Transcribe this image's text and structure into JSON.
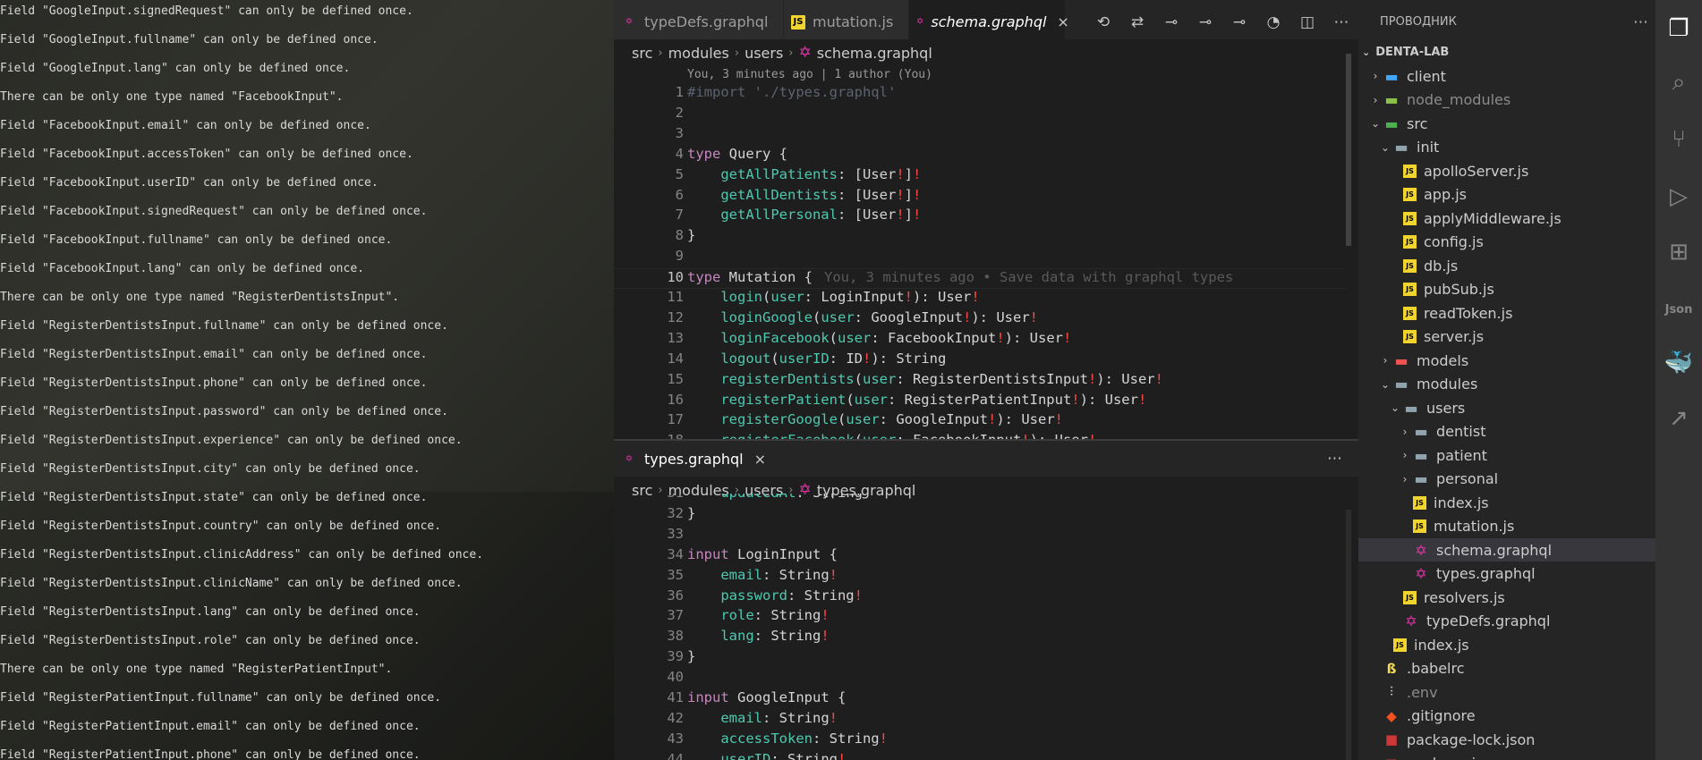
{
  "terminal": {
    "lines": [
      "Field \"GoogleInput.signedRequest\" can only be defined once.",
      "Field \"GoogleInput.fullname\" can only be defined once.",
      "Field \"GoogleInput.lang\" can only be defined once.",
      "There can be only one type named \"FacebookInput\".",
      "Field \"FacebookInput.email\" can only be defined once.",
      "Field \"FacebookInput.accessToken\" can only be defined once.",
      "Field \"FacebookInput.userID\" can only be defined once.",
      "Field \"FacebookInput.signedRequest\" can only be defined once.",
      "Field \"FacebookInput.fullname\" can only be defined once.",
      "Field \"FacebookInput.lang\" can only be defined once.",
      "There can be only one type named \"RegisterDentistsInput\".",
      "Field \"RegisterDentistsInput.fullname\" can only be defined once.",
      "Field \"RegisterDentistsInput.email\" can only be defined once.",
      "Field \"RegisterDentistsInput.phone\" can only be defined once.",
      "Field \"RegisterDentistsInput.password\" can only be defined once.",
      "Field \"RegisterDentistsInput.experience\" can only be defined once.",
      "Field \"RegisterDentistsInput.city\" can only be defined once.",
      "Field \"RegisterDentistsInput.state\" can only be defined once.",
      "Field \"RegisterDentistsInput.country\" can only be defined once.",
      "Field \"RegisterDentistsInput.clinicAddress\" can only be defined once.",
      "Field \"RegisterDentistsInput.clinicName\" can only be defined once.",
      "Field \"RegisterDentistsInput.lang\" can only be defined once.",
      "Field \"RegisterDentistsInput.role\" can only be defined once.",
      "There can be only one type named \"RegisterPatientInput\".",
      "Field \"RegisterPatientInput.fullname\" can only be defined once.",
      "Field \"RegisterPatientInput.email\" can only be defined once.",
      "Field \"RegisterPatientInput.phone\" can only be defined once."
    ]
  },
  "editor_top": {
    "tabs": [
      {
        "label": "typeDefs.graphql",
        "icon": "graphql-icon"
      },
      {
        "label": "mutation.js",
        "icon": "js-icon"
      },
      {
        "label": "schema.graphql",
        "icon": "graphql-icon",
        "active": true
      }
    ],
    "breadcrumb": [
      "src",
      "modules",
      "users",
      "schema.graphql"
    ],
    "codelens": "You, 3 minutes ago | 1 author (You)",
    "blame": "You, 3 minutes ago • Save data with graphql types",
    "lines": [
      {
        "n": "1",
        "t": "#import './types.graphql'"
      },
      {
        "n": "2",
        "t": ""
      },
      {
        "n": "3",
        "t": ""
      },
      {
        "n": "4",
        "t": "type Query {"
      },
      {
        "n": "5",
        "t": "    getAllPatients: [User!]!"
      },
      {
        "n": "6",
        "t": "    getAllDentists: [User!]!"
      },
      {
        "n": "7",
        "t": "    getAllPersonal: [User!]!"
      },
      {
        "n": "8",
        "t": "}"
      },
      {
        "n": "9",
        "t": ""
      },
      {
        "n": "10",
        "t": "type Mutation {"
      },
      {
        "n": "11",
        "t": "    login(user: LoginInput!): User!"
      },
      {
        "n": "12",
        "t": "    loginGoogle(user: GoogleInput!): User!"
      },
      {
        "n": "13",
        "t": "    loginFacebook(user: FacebookInput!): User!"
      },
      {
        "n": "14",
        "t": "    logout(userID: ID!): String"
      },
      {
        "n": "15",
        "t": "    registerDentists(user: RegisterDentistsInput!): User!"
      },
      {
        "n": "16",
        "t": "    registerPatient(user: RegisterPatientInput!): User!"
      },
      {
        "n": "17",
        "t": "    registerGoogle(user: GoogleInput!): User!"
      },
      {
        "n": "18",
        "t": "    registerFacebook(user: FacebookInput!): User!"
      }
    ]
  },
  "editor_bottom": {
    "tab": {
      "label": "types.graphql",
      "icon": "graphql-icon"
    },
    "breadcrumb": [
      "src",
      "modules",
      "users",
      "types.graphql"
    ],
    "lines": [
      {
        "n": "31",
        "t": "    updatedAt: String"
      },
      {
        "n": "32",
        "t": "}"
      },
      {
        "n": "33",
        "t": ""
      },
      {
        "n": "34",
        "t": "input LoginInput {"
      },
      {
        "n": "35",
        "t": "    email: String!"
      },
      {
        "n": "36",
        "t": "    password: String!"
      },
      {
        "n": "37",
        "t": "    role: String!"
      },
      {
        "n": "38",
        "t": "    lang: String!"
      },
      {
        "n": "39",
        "t": "}"
      },
      {
        "n": "40",
        "t": ""
      },
      {
        "n": "41",
        "t": "input GoogleInput {"
      },
      {
        "n": "42",
        "t": "    email: String!"
      },
      {
        "n": "43",
        "t": "    accessToken: String!"
      },
      {
        "n": "44",
        "t": "    userID: String!"
      }
    ]
  },
  "explorer": {
    "title": "ПРОВОДНИК",
    "project": "DENTA-LAB",
    "items": [
      {
        "label": "client",
        "depth": 1,
        "chev": "›",
        "icon": "client-folder-icon",
        "color": "#42a5f5"
      },
      {
        "label": "node_modules",
        "depth": 1,
        "chev": "›",
        "icon": "node-folder-icon",
        "color": "#8bc34a",
        "dim": true
      },
      {
        "label": "src",
        "depth": 1,
        "chev": "⌄",
        "icon": "src-folder-icon",
        "color": "#4caf50"
      },
      {
        "label": "init",
        "depth": 2,
        "chev": "⌄",
        "icon": "folder-icon",
        "color": "#90a4ae"
      },
      {
        "label": "apolloServer.js",
        "depth": 3,
        "icon": "js-icon"
      },
      {
        "label": "app.js",
        "depth": 3,
        "icon": "js-icon"
      },
      {
        "label": "applyMiddleware.js",
        "depth": 3,
        "icon": "js-icon"
      },
      {
        "label": "config.js",
        "depth": 3,
        "icon": "js-icon"
      },
      {
        "label": "db.js",
        "depth": 3,
        "icon": "js-icon"
      },
      {
        "label": "pubSub.js",
        "depth": 3,
        "icon": "js-icon"
      },
      {
        "label": "readToken.js",
        "depth": 3,
        "icon": "js-icon"
      },
      {
        "label": "server.js",
        "depth": 3,
        "icon": "js-icon"
      },
      {
        "label": "models",
        "depth": 2,
        "chev": "›",
        "icon": "models-folder-icon",
        "color": "#ef5350"
      },
      {
        "label": "modules",
        "depth": 2,
        "chev": "⌄",
        "icon": "folder-icon",
        "color": "#90a4ae"
      },
      {
        "label": "users",
        "depth": 3,
        "chev": "⌄",
        "icon": "folder-icon",
        "color": "#90a4ae"
      },
      {
        "label": "dentist",
        "depth": 4,
        "chev": "›",
        "icon": "folder-icon",
        "color": "#90a4ae"
      },
      {
        "label": "patient",
        "depth": 4,
        "chev": "›",
        "icon": "folder-icon",
        "color": "#90a4ae"
      },
      {
        "label": "personal",
        "depth": 4,
        "chev": "›",
        "icon": "folder-icon",
        "color": "#90a4ae"
      },
      {
        "label": "index.js",
        "depth": 4,
        "icon": "js-icon"
      },
      {
        "label": "mutation.js",
        "depth": 4,
        "icon": "js-icon"
      },
      {
        "label": "schema.graphql",
        "depth": 4,
        "icon": "graphql-icon",
        "selected": true
      },
      {
        "label": "types.graphql",
        "depth": 4,
        "icon": "graphql-icon"
      },
      {
        "label": "resolvers.js",
        "depth": 3,
        "icon": "js-icon"
      },
      {
        "label": "typeDefs.graphql",
        "depth": 3,
        "icon": "graphql-icon"
      },
      {
        "label": "index.js",
        "depth": 2,
        "icon": "js-icon"
      },
      {
        "label": ".babelrc",
        "depth": 1,
        "icon": "babel-icon"
      },
      {
        "label": ".env",
        "depth": 1,
        "icon": "env-icon",
        "dim": true
      },
      {
        "label": ".gitignore",
        "depth": 1,
        "icon": "git-icon"
      },
      {
        "label": "package-lock.json",
        "depth": 1,
        "icon": "npm-icon"
      },
      {
        "label": "package.json",
        "depth": 1,
        "icon": "npm-icon"
      }
    ]
  },
  "activity_bar": [
    "files-icon",
    "search-icon",
    "source-control-icon",
    "run-debug-icon",
    "extensions-icon",
    "json-icon",
    "docker-icon",
    "live-share-icon"
  ],
  "colors": {
    "keyword": "#c586c0",
    "field": "#4ec9b0",
    "bang": "#f44747",
    "accent_graphql": "#e535ab",
    "js_badge": "#f1d52e"
  }
}
